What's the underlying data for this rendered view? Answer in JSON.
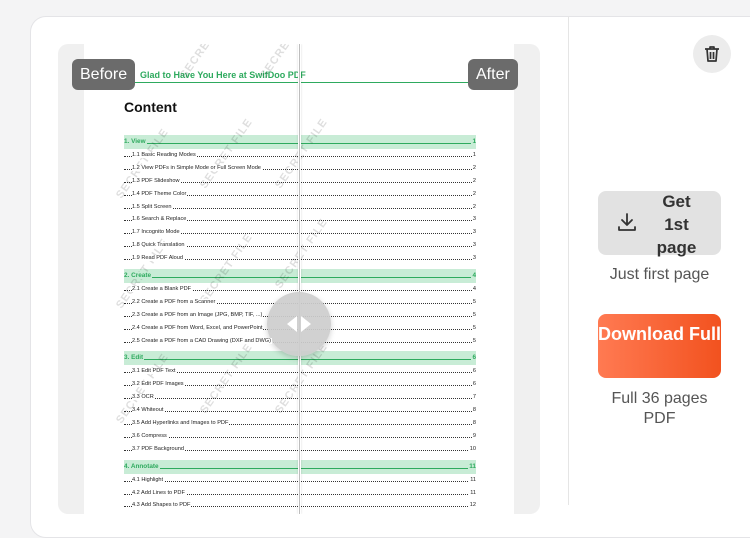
{
  "preview": {
    "before_label": "Before",
    "after_label": "After",
    "doc_header": "Glad to Have You Here at SwifDoo PDF",
    "content_title": "Content",
    "watermark": "SECRET FILE",
    "toc": [
      {
        "title": "1. View",
        "page": "1",
        "level": "section"
      },
      {
        "title": "1.1 Basic Reading Modes",
        "page": "1",
        "level": "sub"
      },
      {
        "title": "1.2 View PDFs in Simple Mode or Full Screen Mode",
        "page": "2",
        "level": "sub"
      },
      {
        "title": "1.3 PDF Slideshow",
        "page": "2",
        "level": "sub"
      },
      {
        "title": "1.4 PDF Theme Color",
        "page": "2",
        "level": "sub"
      },
      {
        "title": "1.5 Split Screen",
        "page": "2",
        "level": "sub"
      },
      {
        "title": "1.6 Search & Replace",
        "page": "3",
        "level": "sub"
      },
      {
        "title": "1.7 Incognito Mode",
        "page": "3",
        "level": "sub"
      },
      {
        "title": "1.8 Quick Translation",
        "page": "3",
        "level": "sub"
      },
      {
        "title": "1.9 Read PDF Aloud",
        "page": "3",
        "level": "sub"
      },
      {
        "title": "2. Create",
        "page": "4",
        "level": "section"
      },
      {
        "title": "2.1 Create a Blank PDF",
        "page": "4",
        "level": "sub"
      },
      {
        "title": "2.2 Create a PDF from a Scanner",
        "page": "5",
        "level": "sub"
      },
      {
        "title": "2.3 Create a PDF from an Image (JPG, BMP, TIF, ...)",
        "page": "5",
        "level": "sub"
      },
      {
        "title": "2.4 Create a PDF from Word, Excel, and PowerPoint",
        "page": "5",
        "level": "sub"
      },
      {
        "title": "2.5 Create a PDF from a CAD Drawing (DXF and DWG)",
        "page": "5",
        "level": "sub"
      },
      {
        "title": "3. Edit",
        "page": "6",
        "level": "section"
      },
      {
        "title": "3.1 Edit PDF Text",
        "page": "6",
        "level": "sub"
      },
      {
        "title": "3.2 Edit PDF Images",
        "page": "6",
        "level": "sub"
      },
      {
        "title": "3.3 OCR",
        "page": "7",
        "level": "sub"
      },
      {
        "title": "3.4 Whiteout",
        "page": "8",
        "level": "sub"
      },
      {
        "title": "3.5 Add Hyperlinks and Images to PDF",
        "page": "8",
        "level": "sub"
      },
      {
        "title": "3.6 Compress",
        "page": "9",
        "level": "sub"
      },
      {
        "title": "3.7 PDF Background",
        "page": "10",
        "level": "sub"
      },
      {
        "title": "4. Annotate",
        "page": "11",
        "level": "section"
      },
      {
        "title": "4.1 Highlight",
        "page": "11",
        "level": "sub"
      },
      {
        "title": "4.2 Add Lines to PDF",
        "page": "11",
        "level": "sub"
      },
      {
        "title": "4.3 Add Shapes to PDF",
        "page": "12",
        "level": "sub"
      }
    ]
  },
  "sidebar": {
    "get_first_label": "Get 1st page",
    "get_first_note": "Just first page",
    "download_full_label": "Download Full",
    "download_full_note": "Full 36 pages PDF"
  },
  "colors": {
    "accent_orange": "#f2521f",
    "doc_green": "#2eaa5e",
    "tag_gray": "#6b6b6b"
  }
}
